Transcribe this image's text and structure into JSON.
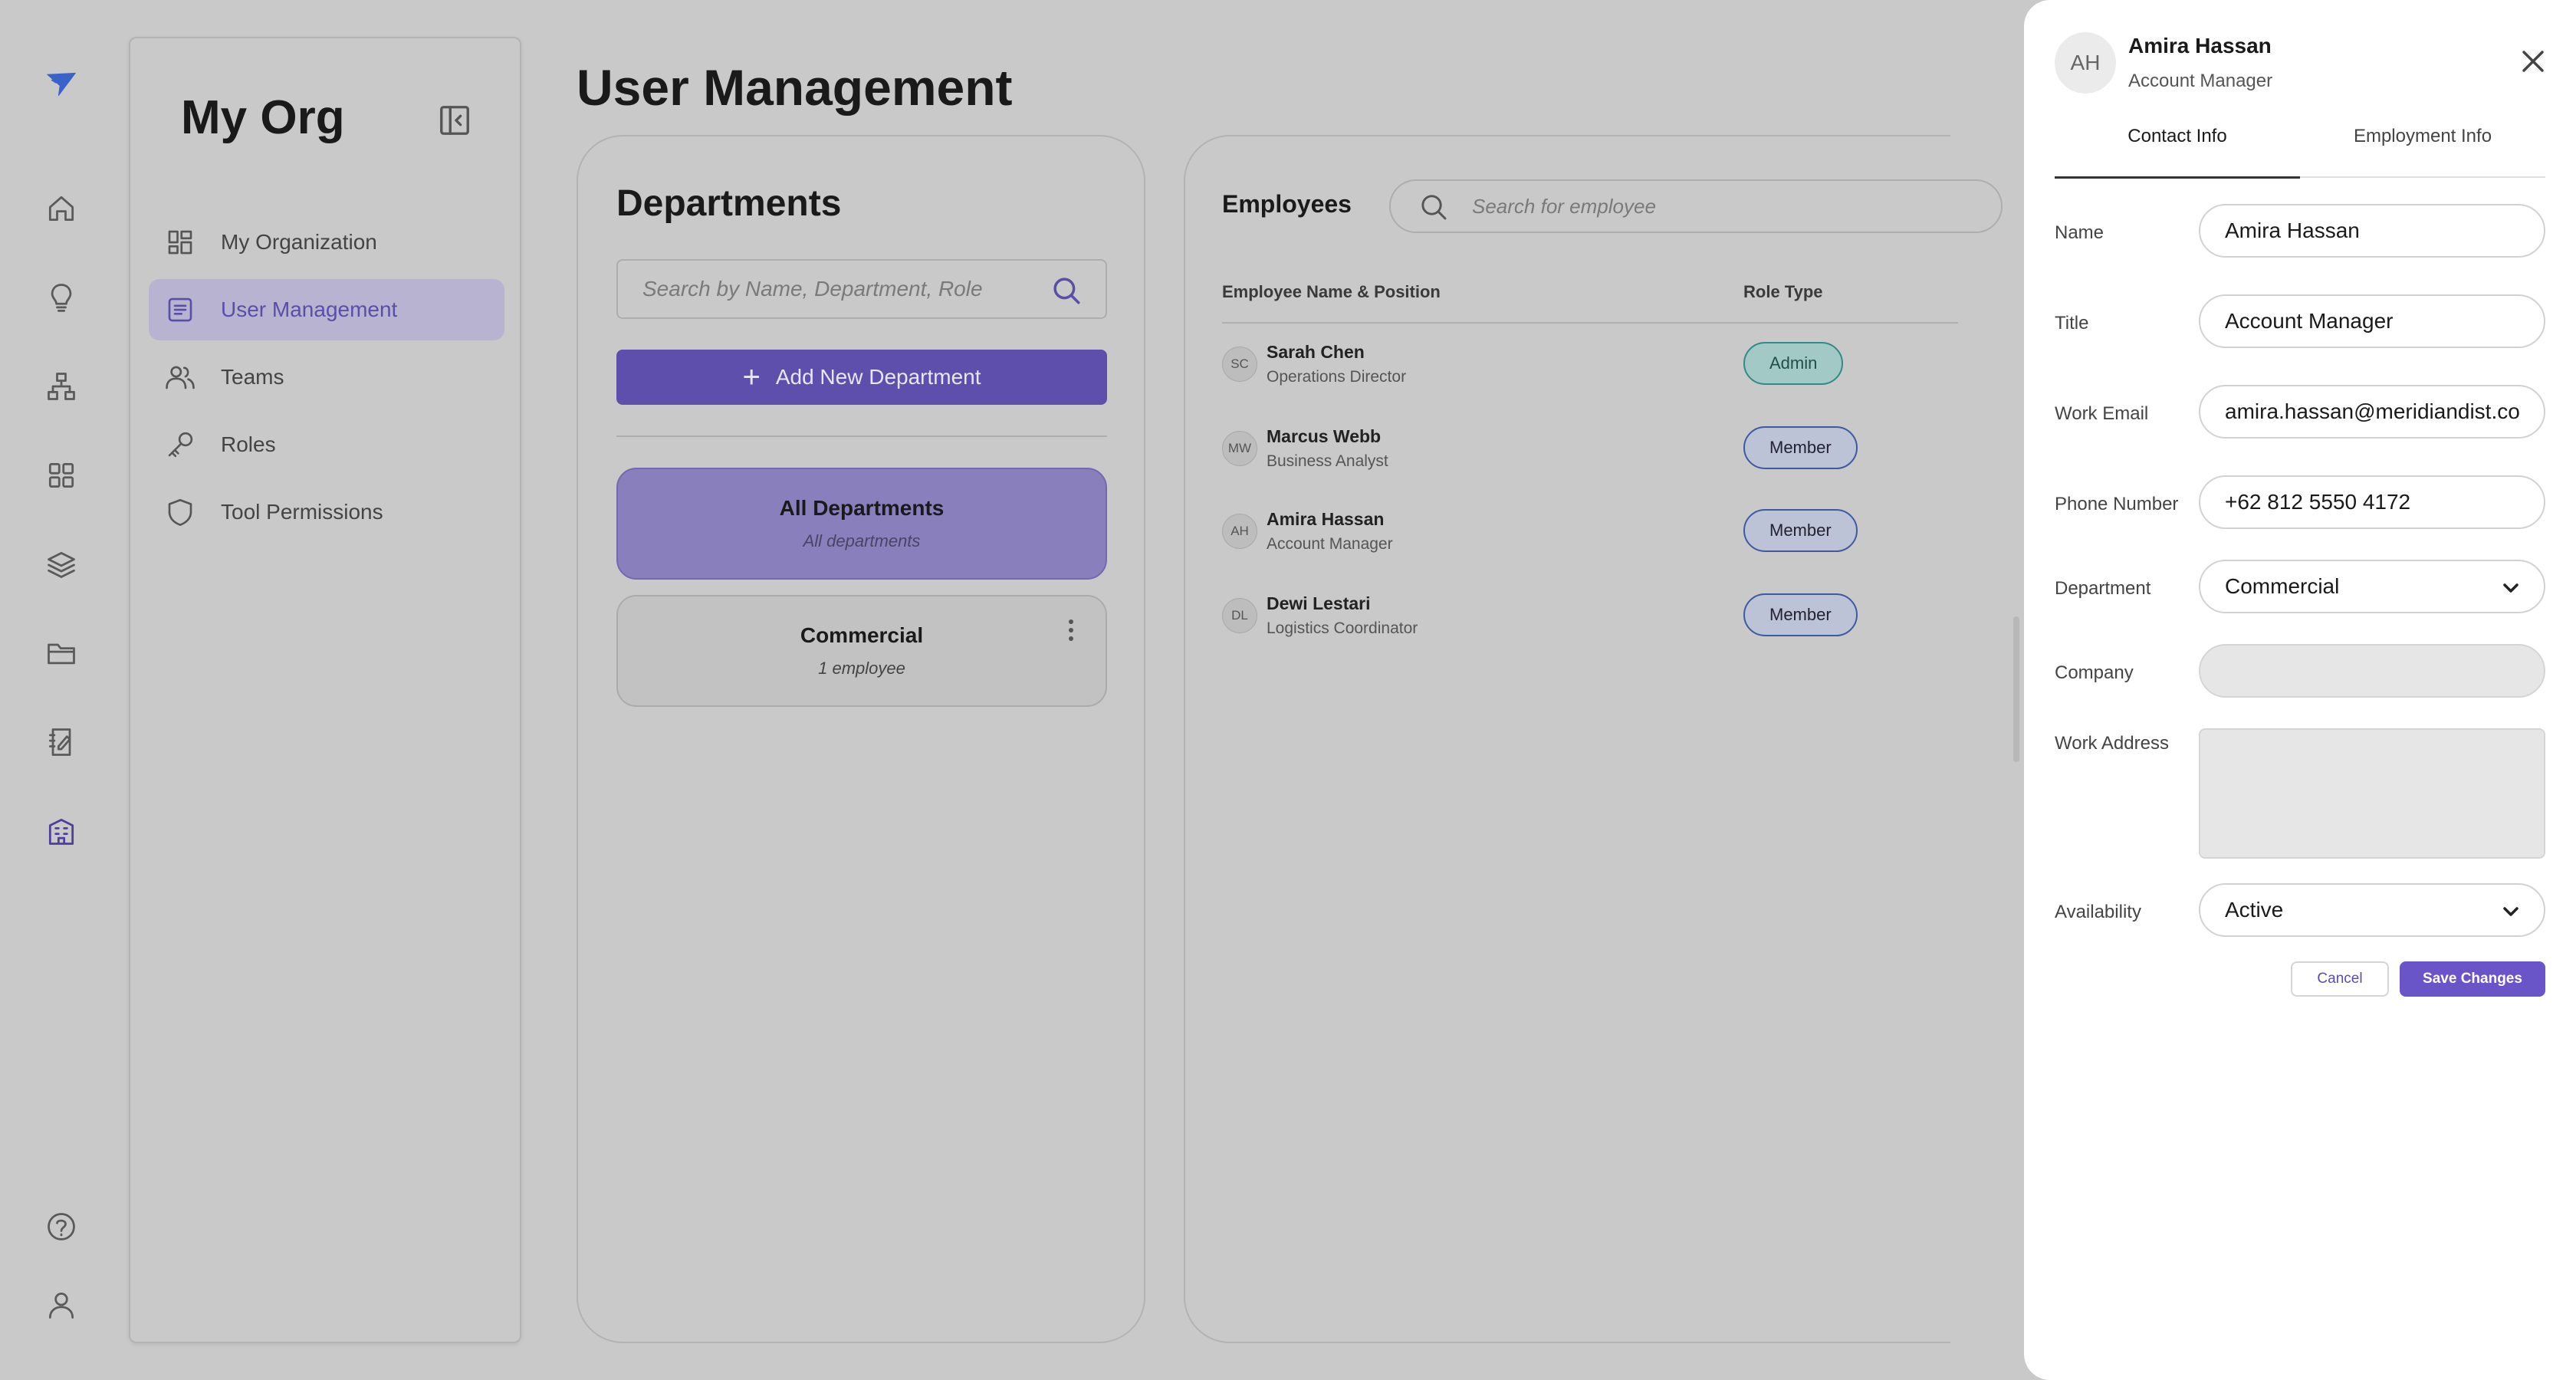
{
  "rail": {
    "logo": "paper-plane-logo",
    "items": [
      "home-icon",
      "lightbulb-icon",
      "org-chart-icon",
      "grid-icon",
      "layers-icon",
      "folder-icon",
      "notebook-icon",
      "building-icon"
    ],
    "bottom": [
      "help-icon",
      "user-icon"
    ]
  },
  "org": {
    "title": "My Org",
    "nav": [
      {
        "label": "My Organization",
        "icon": "dashboard-icon"
      },
      {
        "label": "User Management",
        "icon": "user-list-icon",
        "active": true
      },
      {
        "label": "Teams",
        "icon": "teams-icon"
      },
      {
        "label": "Roles",
        "icon": "key-icon"
      },
      {
        "label": "Tool Permissions",
        "icon": "shield-icon"
      }
    ]
  },
  "page": {
    "title": "User Management"
  },
  "departments": {
    "heading": "Departments",
    "search_placeholder": "Search by Name, Department, Role",
    "add_label": "Add New Department",
    "items": [
      {
        "name": "All Departments",
        "count": "All departments",
        "selected": true
      },
      {
        "name": "Commercial",
        "count": "1 employee"
      }
    ]
  },
  "employees": {
    "heading": "Employees",
    "search_placeholder": "Search for employee",
    "col_name": "Employee Name & Position",
    "col_role": "Role Type",
    "rows": [
      {
        "initials": "SC",
        "name": "Sarah Chen",
        "position": "Operations Director",
        "role": "Admin"
      },
      {
        "initials": "MW",
        "name": "Marcus Webb",
        "position": "Business Analyst",
        "role": "Member"
      },
      {
        "initials": "AH",
        "name": "Amira Hassan",
        "position": "Account Manager",
        "role": "Member"
      },
      {
        "initials": "DL",
        "name": "Dewi Lestari",
        "position": "Logistics Coordinator",
        "role": "Member"
      }
    ]
  },
  "drawer": {
    "initials": "AH",
    "name": "Amira Hassan",
    "role": "Account Manager",
    "tabs": [
      "Contact Info",
      "Employment Info"
    ],
    "labels": {
      "name": "Name",
      "title": "Title",
      "email": "Work Email",
      "phone": "Phone Number",
      "department": "Department",
      "company": "Company",
      "address": "Work Address",
      "availability": "Availability"
    },
    "values": {
      "name": "Amira Hassan",
      "title": "Account Manager",
      "email": "amira.hassan@meridiandist.co",
      "phone": "+62 812 5550 4172",
      "department": "Commercial",
      "company": "",
      "address": "",
      "availability": "Active"
    },
    "cancel": "Cancel",
    "save": "Save Changes"
  },
  "colors": {
    "accent": "#5e4fad",
    "admin_badge": "#a3c9c6",
    "member_badge": "#bcc3d6"
  }
}
